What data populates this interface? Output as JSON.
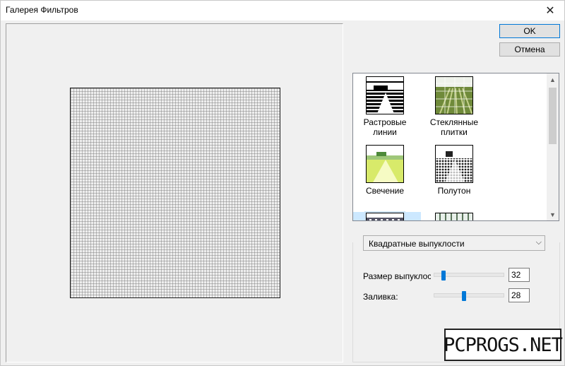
{
  "window": {
    "title": "Галерея Фильтров"
  },
  "buttons": {
    "ok": "OK",
    "cancel": "Отмена"
  },
  "filters": [
    {
      "label": "Растровые линии",
      "icon": "raster-lines-thumbnail"
    },
    {
      "label": "Стеклянные плитки",
      "icon": "glass-tiles-thumbnail"
    },
    {
      "label": "Свечение",
      "icon": "glow-thumbnail"
    },
    {
      "label": "Полутон",
      "icon": "halftone-thumbnail"
    }
  ],
  "settings": {
    "selected_filter": "Квадратные выпуклости",
    "params": [
      {
        "label": "Размер выпуклос",
        "value": "32",
        "level": 0.12
      },
      {
        "label": "Заливка:",
        "value": "28",
        "level": 0.43
      }
    ]
  },
  "watermark": "PCPROGS.NET",
  "colors": {
    "accent": "#0078d7",
    "selection": "#cce8ff"
  }
}
